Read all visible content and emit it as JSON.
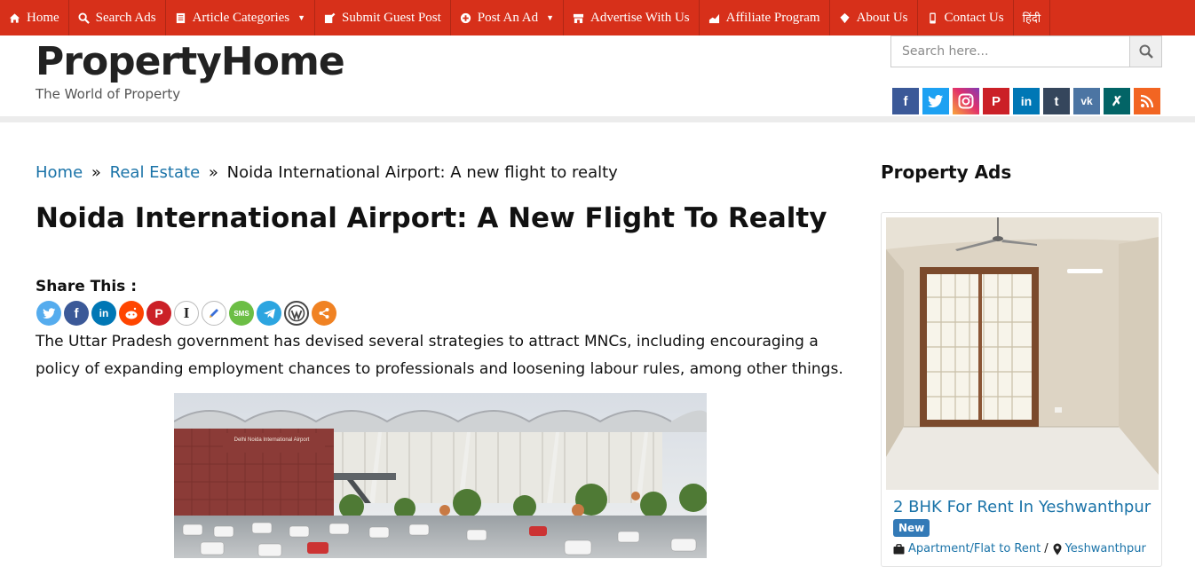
{
  "nav": {
    "items": [
      {
        "label": "Home",
        "icon": "home-icon"
      },
      {
        "label": "Search Ads",
        "icon": "search-icon"
      },
      {
        "label": "Article Categories",
        "icon": "document-icon",
        "dropdown": true
      },
      {
        "label": "Submit Guest Post",
        "icon": "edit-icon"
      },
      {
        "label": "Post An Ad",
        "icon": "plus-circle-icon",
        "dropdown": true
      },
      {
        "label": "Advertise With Us",
        "icon": "store-icon"
      },
      {
        "label": "Affiliate Program",
        "icon": "chart-icon"
      },
      {
        "label": "About Us",
        "icon": "diamond-icon"
      },
      {
        "label": "Contact Us",
        "icon": "phone-icon"
      },
      {
        "label": "हिंदी",
        "icon": ""
      }
    ],
    "bg_color": "#d7301a"
  },
  "header": {
    "site_name": "PropertyHome",
    "tagline": "The World of Property",
    "search_placeholder": "Search here...",
    "social": [
      "facebook-icon",
      "twitter-icon",
      "instagram-icon",
      "pinterest-icon",
      "linkedin-icon",
      "tumblr-icon",
      "vk-icon",
      "xing-icon",
      "rss-icon"
    ]
  },
  "breadcrumb": {
    "home": "Home",
    "sep1": "»",
    "category": "Real Estate",
    "sep2": "»",
    "current": "Noida International Airport: A new flight to realty"
  },
  "article": {
    "title": "Noida International Airport: A New Flight To Realty",
    "share_label": "Share This :",
    "share_icons": [
      "twitter-icon",
      "facebook-icon",
      "linkedin-icon",
      "reddit-icon",
      "pinterest-icon",
      "instapaper-icon",
      "blogger-icon",
      "sms-icon",
      "telegram-icon",
      "wordpress-icon",
      "more-share-icon"
    ],
    "body": "The Uttar Pradesh government has devised several strategies to attract MNCs, including encouraging a policy of expanding employment chances to professionals and loosening labour rules, among other things.",
    "image_sign": "Delhi Noida International Airport"
  },
  "sidebar": {
    "title": "Property Ads",
    "ad": {
      "title": "2 BHK For Rent In Yeshwanthpur",
      "badge": "New",
      "separator": "/",
      "category": "Apartment/Flat to Rent",
      "location": "Yeshwanthpur"
    }
  },
  "colors": {
    "link": "#1a73a8",
    "badge": "#337ab7"
  }
}
